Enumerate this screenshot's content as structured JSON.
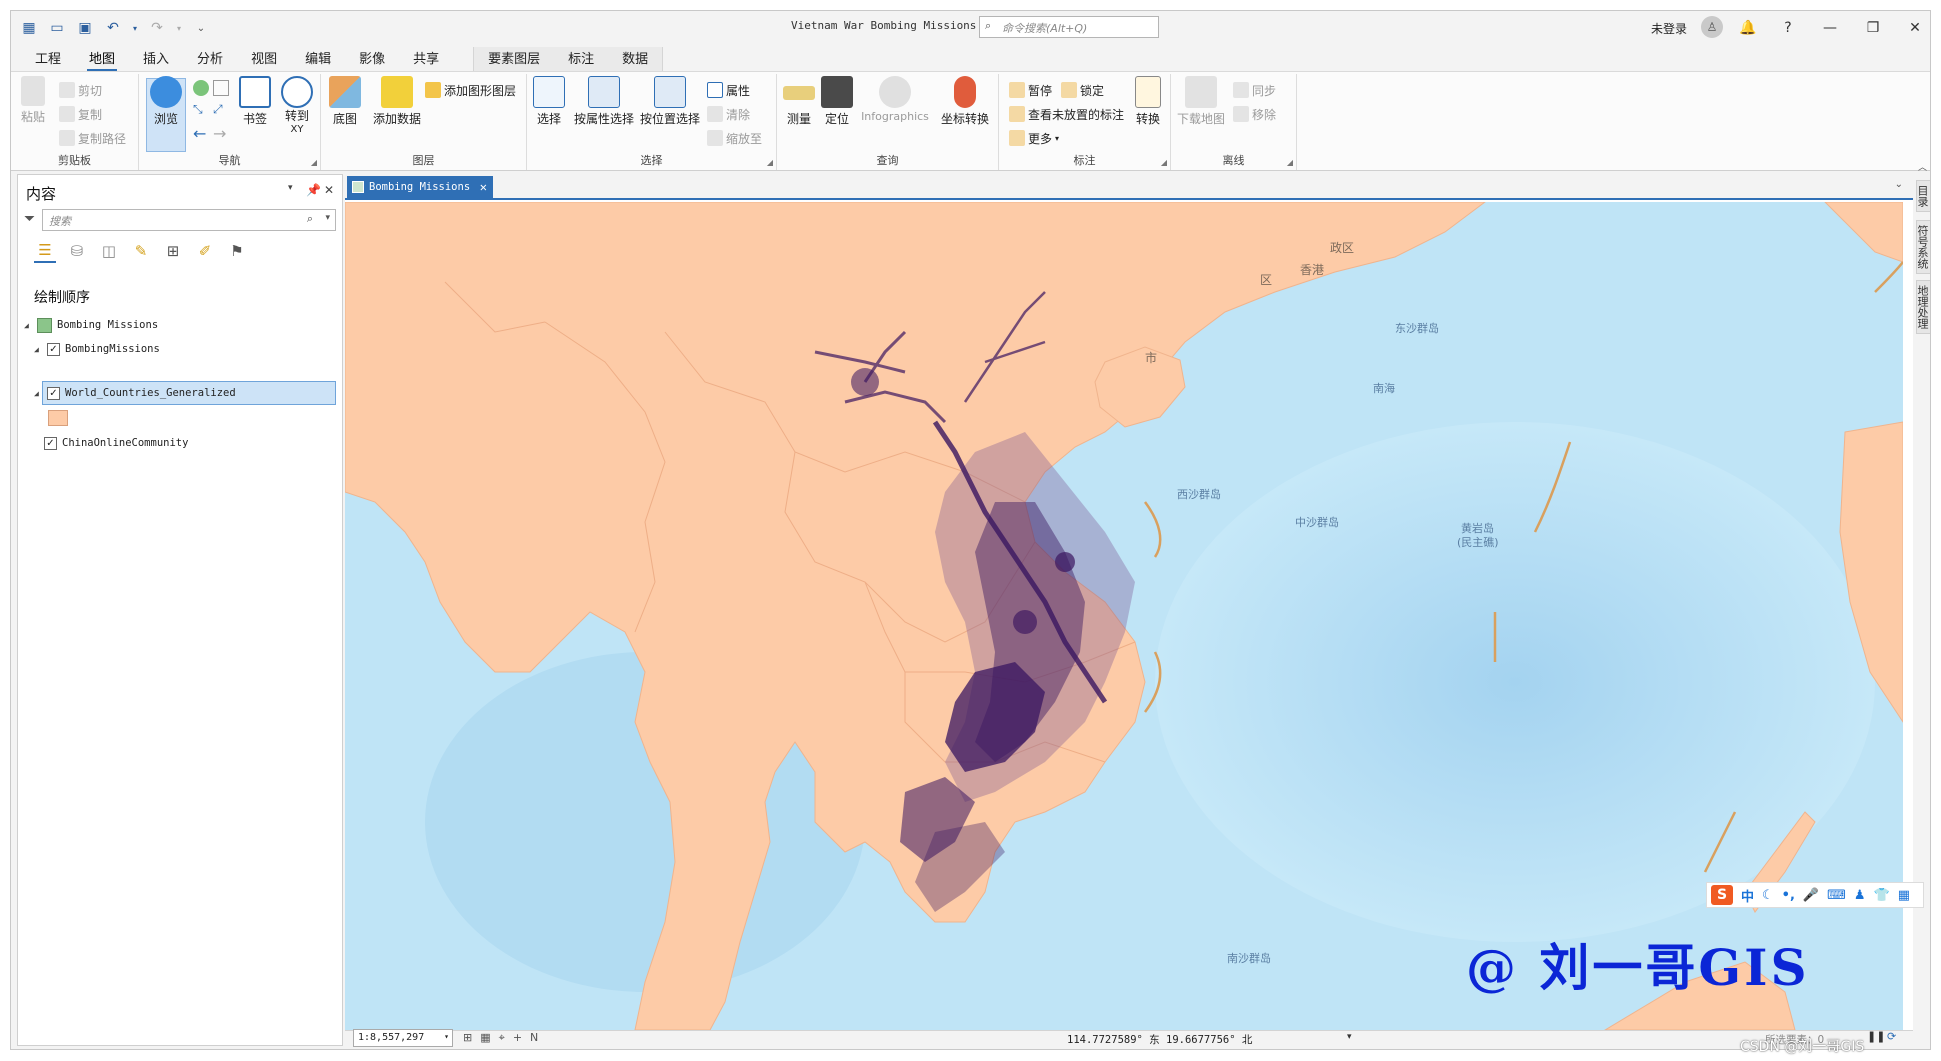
{
  "window": {
    "title": "Vietnam War Bombing Missions",
    "command_search_placeholder": "命令搜索(Alt+Q)",
    "signin": "未登录"
  },
  "ribbon_tabs": [
    "工程",
    "地图",
    "插入",
    "分析",
    "视图",
    "编辑",
    "影像",
    "共享"
  ],
  "context_tabs": [
    "要素图层",
    "标注",
    "数据"
  ],
  "active_tab": "地图",
  "ribbon": {
    "clipboard": {
      "label": "剪贴板",
      "paste": "粘贴",
      "cut": "剪切",
      "copy": "复制",
      "copy_path": "复制路径"
    },
    "navigate": {
      "label": "导航",
      "explore": "浏览",
      "bookmarks": "书签",
      "goto_xy": "转到",
      "goto_xy_sub": "XY"
    },
    "layer": {
      "label": "图层",
      "basemap": "底图",
      "add_data": "添加数据",
      "add_graphics_layer": "添加图形图层"
    },
    "selection": {
      "label": "选择",
      "select": "选择",
      "select_by_attributes": "按属性选择",
      "select_by_location": "按位置选择",
      "attributes": "属性",
      "clear": "清除",
      "zoom_to": "缩放至"
    },
    "inquiry": {
      "label": "查询",
      "measure": "测量",
      "locate": "定位",
      "infographics": "Infographics",
      "coordinate_conversion": "坐标转换"
    },
    "labeling": {
      "label": "标注",
      "pause": "暂停",
      "lock": "锁定",
      "view_unplaced": "查看未放置的标注",
      "more": "更多",
      "convert": "转换"
    },
    "offline": {
      "label": "离线",
      "download_map": "下载地图",
      "sync": "同步",
      "remove": "移除"
    }
  },
  "contents_pane": {
    "title": "内容",
    "search_placeholder": "搜索",
    "section": "绘制顺序",
    "map_name": "Bombing Missions",
    "layers": [
      {
        "name": "BombingMissions",
        "checked": true
      },
      {
        "name": "World_Countries_Generalized",
        "checked": true,
        "selected": true
      },
      {
        "name": "ChinaOnlineCommunity",
        "checked": true
      }
    ]
  },
  "map_tab": "Bombing Missions",
  "map_labels": {
    "hongkong": "香港",
    "district": "区",
    "district2": "政区",
    "city": "市",
    "dongsha": "东沙群岛",
    "nanhai": "南海",
    "xisha": "西沙群岛",
    "zhongsha": "中沙群岛",
    "huangyan": "黄岩岛",
    "huangyan_sub": "(民主礁)",
    "nansha": "南沙群岛"
  },
  "status": {
    "scale": "1:8,557,297",
    "coordinates": "114.7727589° 东  19.6677756° 北",
    "selected_features": "所选要素：0"
  },
  "side_dock": [
    "目录",
    "符号系统",
    "地理处理"
  ],
  "overlays": {
    "ime_logo": "S",
    "ime_lang": "中",
    "watermark": "@ 刘一哥GIS",
    "csdn": "CSDN @刘一哥GIS"
  },
  "colors": {
    "accent": "#2f6fb5",
    "land": "#fdcba7",
    "ocean": "#b6def3",
    "bombing": "#3a1660",
    "watermark": "#0b26d6"
  }
}
